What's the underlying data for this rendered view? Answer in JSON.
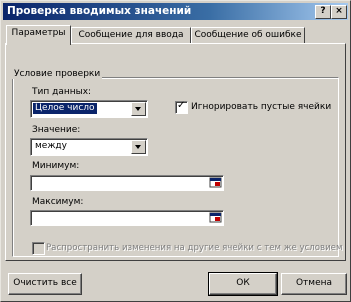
{
  "window": {
    "title": "Проверка вводимых значений",
    "help_button": "?",
    "close_button": "×"
  },
  "tabs": [
    {
      "label": "Параметры"
    },
    {
      "label": "Сообщение для ввода"
    },
    {
      "label": "Сообщение об ошибке"
    }
  ],
  "group": {
    "legend": "Условие проверки",
    "data_type_label": "Тип данных:",
    "data_type_value": "Целое число",
    "ignore_blank_label": "Игнорировать пустые ячейки",
    "ignore_blank_checked": true,
    "value_label": "Значение:",
    "value_value": "между",
    "min_label": "Минимум:",
    "min_value": "",
    "max_label": "Максимум:",
    "max_value": "",
    "propagate_label": "Распространить изменения на другие ячейки с тем же условием"
  },
  "buttons": {
    "clear_all": "Очистить все",
    "ok": "ОК",
    "cancel": "Отмена"
  }
}
